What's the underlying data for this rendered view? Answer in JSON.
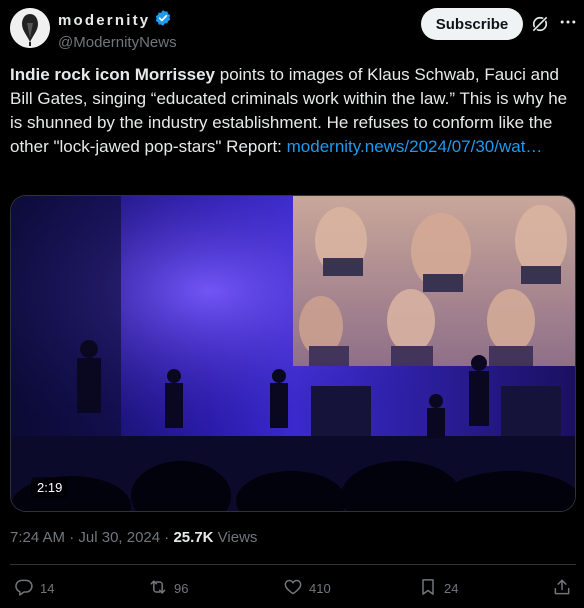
{
  "account": {
    "display_name": "modernity",
    "handle": "@ModernityNews",
    "verified_color": "#1d9bf0"
  },
  "header": {
    "subscribe_label": "Subscribe",
    "icons": [
      "grok-icon",
      "more-icon"
    ]
  },
  "tweet": {
    "bold_lead": "Indie rock icon Morrissey",
    "body": " points to images of Klaus Schwab, Fauci and Bill Gates, singing “educated criminals work within the law.” This is why he is shunned by the industry establishment. He refuses to conform like the other \"lock-jawed pop-stars\" Report: ",
    "link_text": "modernity.news/2024/07/30/wat…"
  },
  "media": {
    "duration": "2:19"
  },
  "meta": {
    "time": "7:24 AM",
    "separator": " · ",
    "date": "Jul 30, 2024",
    "views_count": "25.7K",
    "views_label": "Views"
  },
  "actions": {
    "replies": "14",
    "reposts": "96",
    "likes": "410",
    "bookmarks": "24"
  },
  "colors": {
    "background": "#000000",
    "text": "#e7e9ea",
    "muted": "#71767b",
    "link": "#1d9bf0"
  }
}
